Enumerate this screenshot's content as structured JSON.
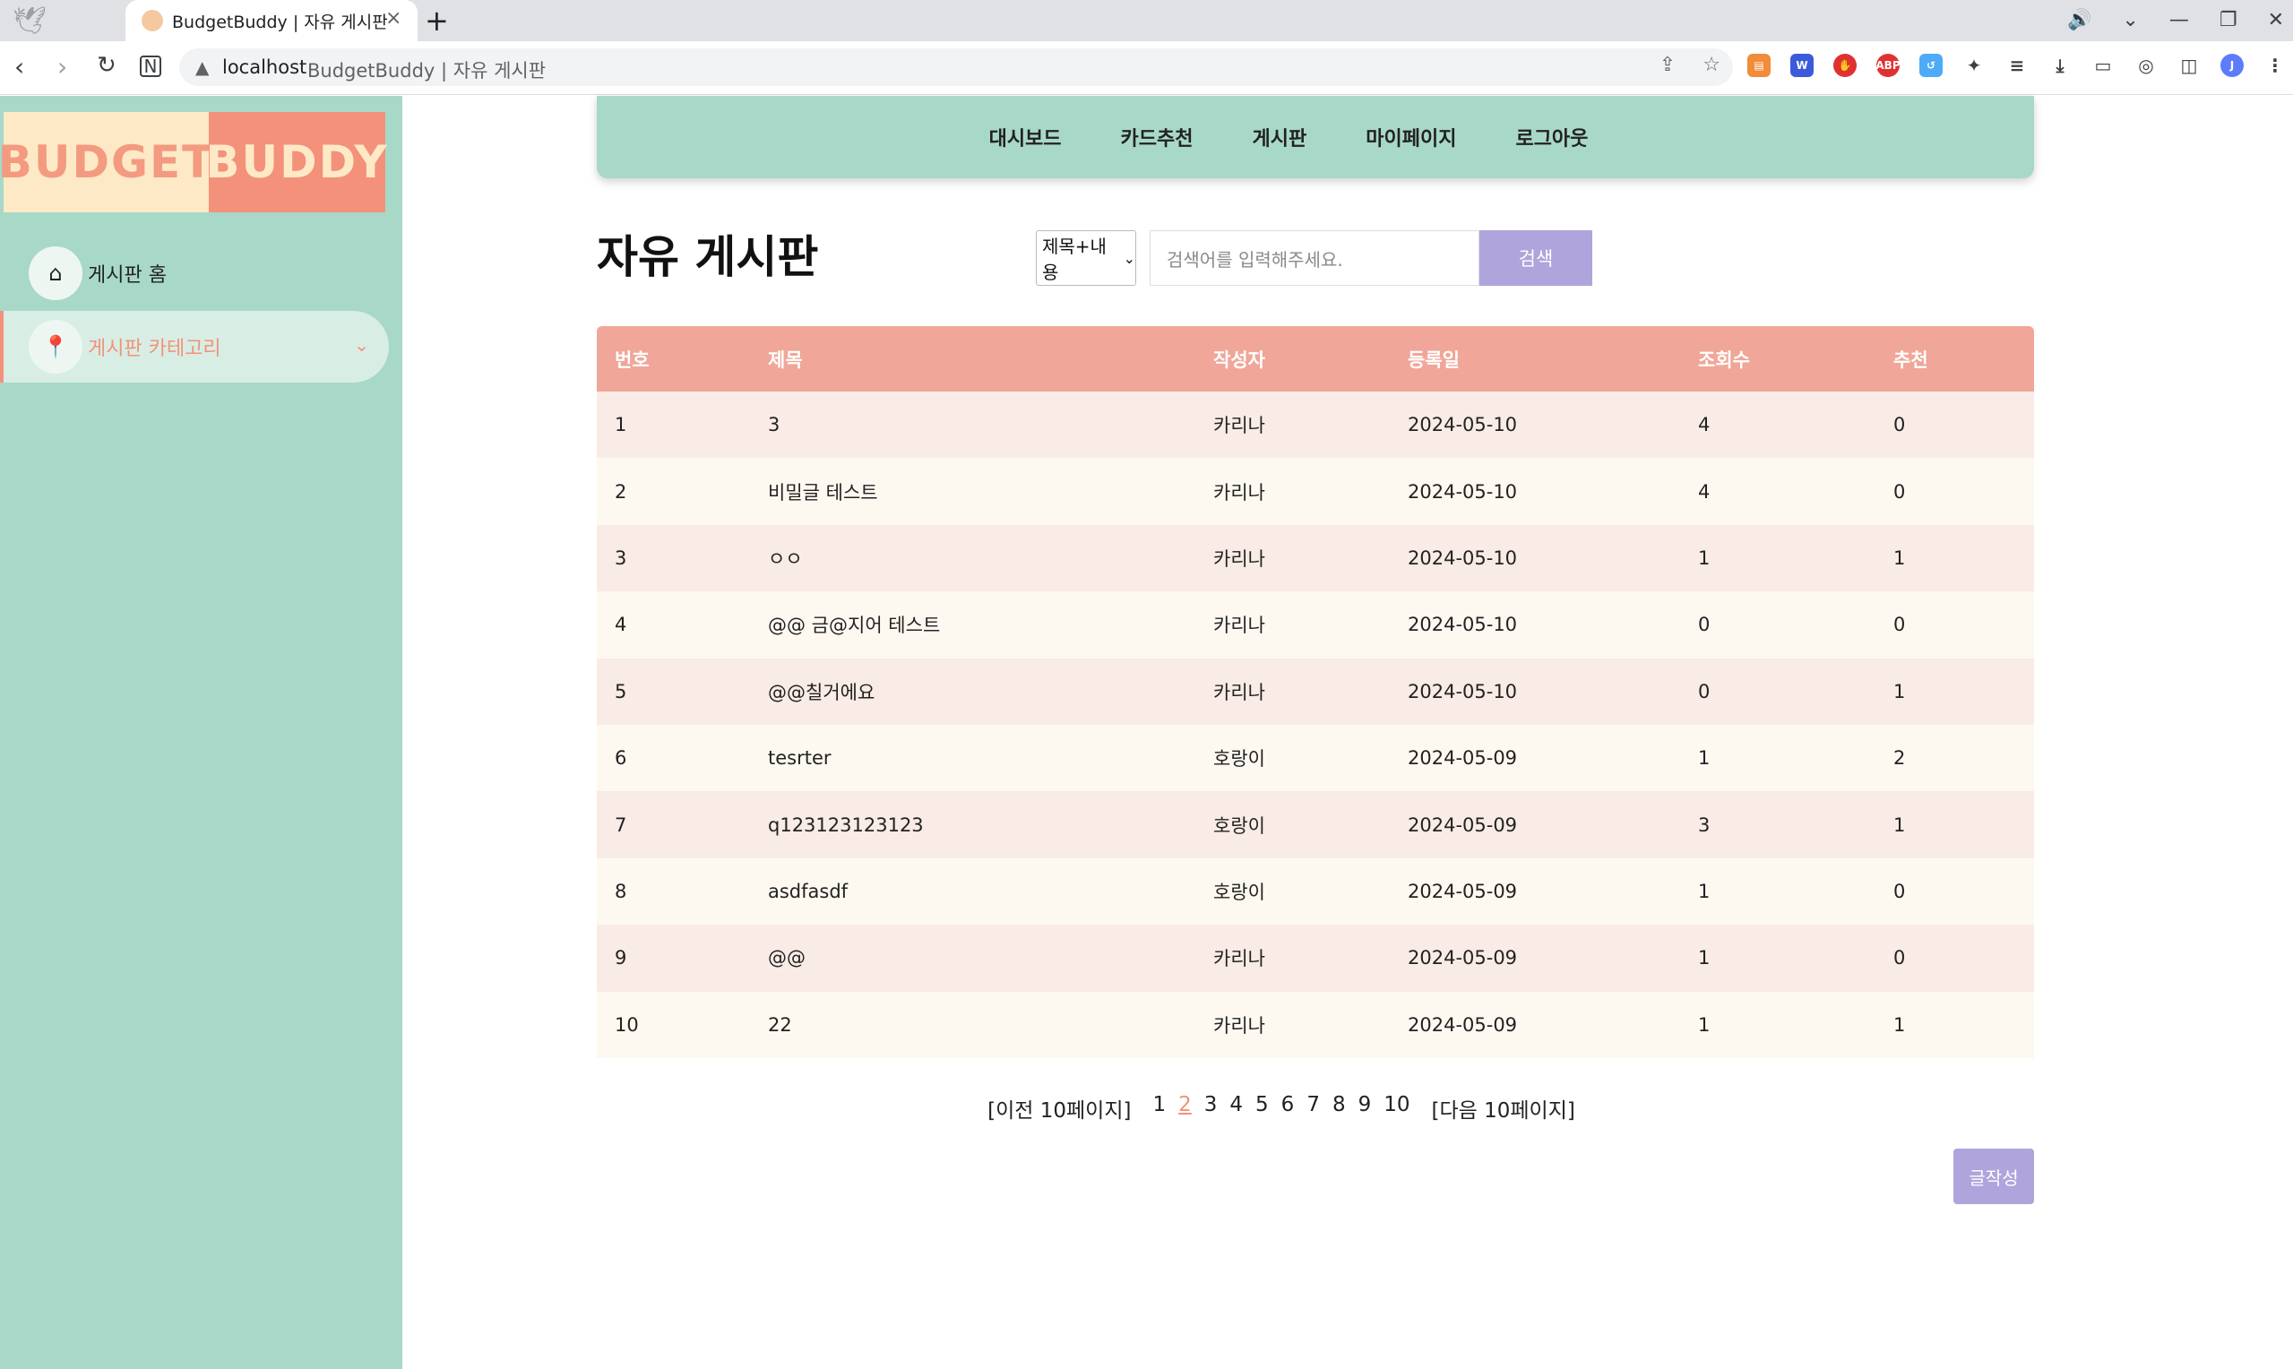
{
  "browser": {
    "tab_title": "BudgetBuddy | 자유 게시판",
    "url_host": "localhost",
    "url_title": "BudgetBuddy | 자유 게시판"
  },
  "logo": {
    "left": "BUDGET",
    "right": "BUDDY"
  },
  "sidebar": {
    "home_label": "게시판 홈",
    "category_label": "게시판 카테고리"
  },
  "topnav": [
    "대시보드",
    "카드추천",
    "게시판",
    "마이페이지",
    "로그아웃"
  ],
  "board": {
    "title": "자유 게시판",
    "search_option": "제목+내용",
    "search_placeholder": "검색어를 입력해주세요.",
    "search_button": "검색",
    "columns": [
      "번호",
      "제목",
      "작성자",
      "등록일",
      "조회수",
      "추천"
    ],
    "rows": [
      [
        "1",
        "3",
        "카리나",
        "2024-05-10",
        "4",
        "0"
      ],
      [
        "2",
        "비밀글 테스트",
        "카리나",
        "2024-05-10",
        "4",
        "0"
      ],
      [
        "3",
        "ㅇㅇ",
        "카리나",
        "2024-05-10",
        "1",
        "1"
      ],
      [
        "4",
        "@@ 금@지어 테스트",
        "카리나",
        "2024-05-10",
        "0",
        "0"
      ],
      [
        "5",
        "@@칠거에요",
        "카리나",
        "2024-05-10",
        "0",
        "1"
      ],
      [
        "6",
        "tesrter",
        "호랑이",
        "2024-05-09",
        "1",
        "2"
      ],
      [
        "7",
        "q123123123123",
        "호랑이",
        "2024-05-09",
        "3",
        "1"
      ],
      [
        "8",
        "asdfasdf",
        "호랑이",
        "2024-05-09",
        "1",
        "0"
      ],
      [
        "9",
        "@@",
        "카리나",
        "2024-05-09",
        "1",
        "0"
      ],
      [
        "10",
        "22",
        "카리나",
        "2024-05-09",
        "1",
        "1"
      ]
    ],
    "pagination": {
      "prev": "[이전 10페이지]",
      "pages": [
        "1",
        "2",
        "3",
        "4",
        "5",
        "6",
        "7",
        "8",
        "9",
        "10"
      ],
      "current": "2",
      "next": "[다음 10페이지]"
    },
    "write_button": "글작성"
  },
  "colors": {
    "sidebar": "#a8d8c8",
    "accent": "#f4917a",
    "table_header": "#f0a698",
    "button": "#b0a4dc"
  }
}
